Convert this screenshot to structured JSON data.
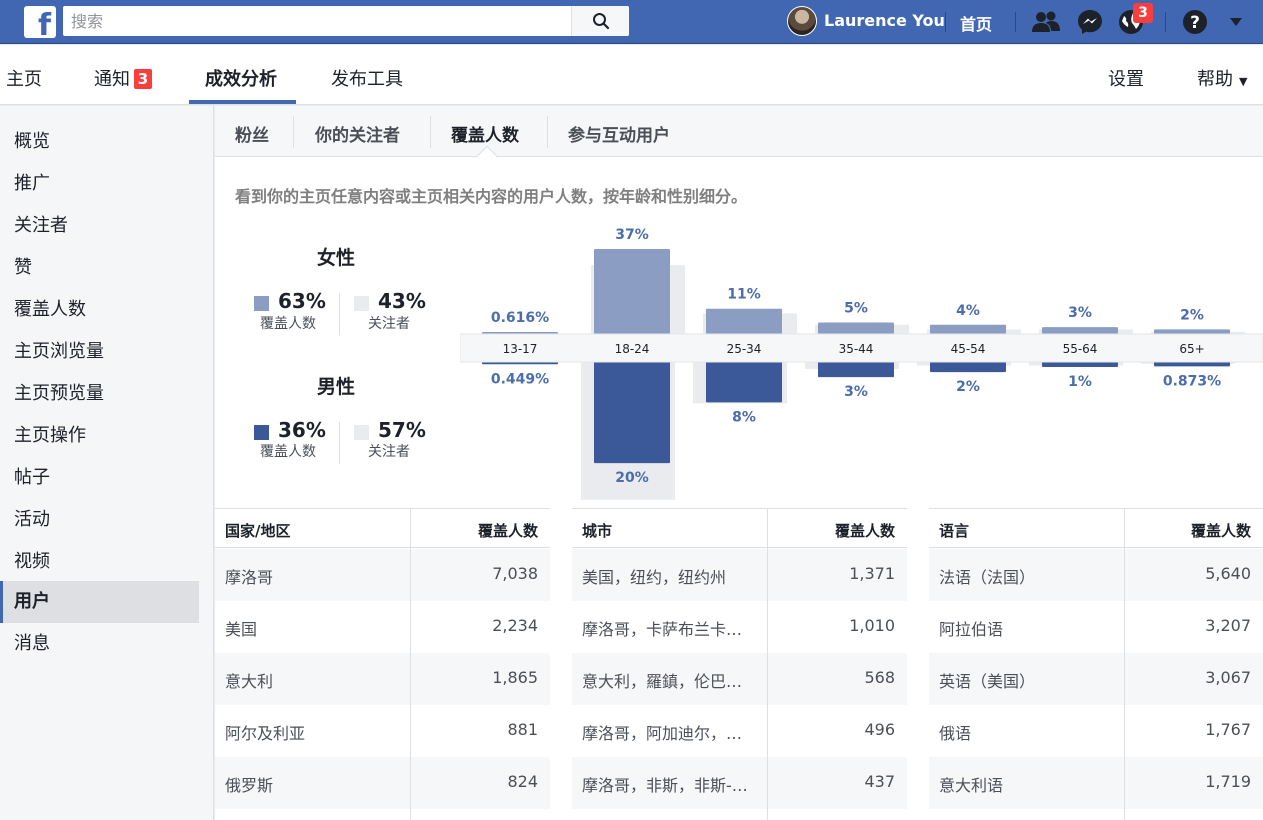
{
  "topbar": {
    "logo": "f",
    "search_placeholder": "搜索",
    "user_name": "Laurence You",
    "home_label": "首页",
    "notification_count": "3"
  },
  "page_nav": {
    "items": [
      "主页",
      "通知",
      "成效分析",
      "发布工具"
    ],
    "notify_badge": "3",
    "active": "成效分析",
    "settings": "设置",
    "help": "帮助"
  },
  "sidebar": {
    "items": [
      "概览",
      "推广",
      "关注者",
      "赞",
      "覆盖人数",
      "主页浏览量",
      "主页预览量",
      "主页操作",
      "帖子",
      "活动",
      "视频",
      "用户",
      "消息"
    ],
    "active": "用户"
  },
  "subtabs": {
    "items": [
      "粉丝",
      "你的关注者",
      "覆盖人数",
      "参与互动用户"
    ],
    "active": "覆盖人数"
  },
  "description": "看到你的主页任意内容或主页相关内容的用户人数，按年龄和性别细分。",
  "gender": {
    "female": {
      "title": "女性",
      "reach_pct": "63%",
      "reach_label": "覆盖人数",
      "follower_pct": "43%",
      "follower_label": "关注者"
    },
    "male": {
      "title": "男性",
      "reach_pct": "36%",
      "reach_label": "覆盖人数",
      "follower_pct": "57%",
      "follower_label": "关注者"
    }
  },
  "colors": {
    "female_reach": "#8b9dc3",
    "male_reach": "#3b5998",
    "followers": "#e9ebee",
    "label_female": "#4b6dab",
    "label_male": "#4b6dab"
  },
  "chart_data": {
    "type": "bar",
    "categories": [
      "13-17",
      "18-24",
      "25-34",
      "35-44",
      "45-54",
      "55-64",
      "65+"
    ],
    "series": [
      {
        "name": "女性 覆盖人数",
        "values": [
          0.616,
          37,
          11,
          5,
          4,
          3,
          2
        ],
        "labels": [
          "0.616%",
          "37%",
          "11%",
          "5%",
          "4%",
          "3%",
          "2%"
        ]
      },
      {
        "name": "男性 覆盖人数",
        "values": [
          0.449,
          20,
          8,
          3,
          2,
          1,
          0.873
        ],
        "labels": [
          "0.449%",
          "20%",
          "8%",
          "3%",
          "2%",
          "1%",
          "0.873%"
        ]
      }
    ],
    "follower_female": [
      0,
      30,
      9,
      4,
      2,
      2,
      1
    ],
    "follower_male": [
      0,
      40,
      12,
      2,
      1,
      1,
      0.5
    ]
  },
  "tables": [
    {
      "col1": "国家/地区",
      "col2": "覆盖人数",
      "rows": [
        [
          "摩洛哥",
          "7,038"
        ],
        [
          "美国",
          "2,234"
        ],
        [
          "意大利",
          "1,865"
        ],
        [
          "阿尔及利亚",
          "881"
        ],
        [
          "俄罗斯",
          "824"
        ]
      ]
    },
    {
      "col1": "城市",
      "col2": "覆盖人数",
      "rows": [
        [
          "美国，纽约，纽约州",
          "1,371"
        ],
        [
          "摩洛哥，卡萨布兰卡…",
          "1,010"
        ],
        [
          "意大利，羅鎮，伦巴…",
          "568"
        ],
        [
          "摩洛哥，阿加迪尔，…",
          "496"
        ],
        [
          "摩洛哥，非斯，非斯-…",
          "437"
        ]
      ]
    },
    {
      "col1": "语言",
      "col2": "覆盖人数",
      "rows": [
        [
          "法语（法国）",
          "5,640"
        ],
        [
          "阿拉伯语",
          "3,207"
        ],
        [
          "英语（美国）",
          "3,067"
        ],
        [
          "俄语",
          "1,767"
        ],
        [
          "意大利语",
          "1,719"
        ]
      ]
    }
  ]
}
